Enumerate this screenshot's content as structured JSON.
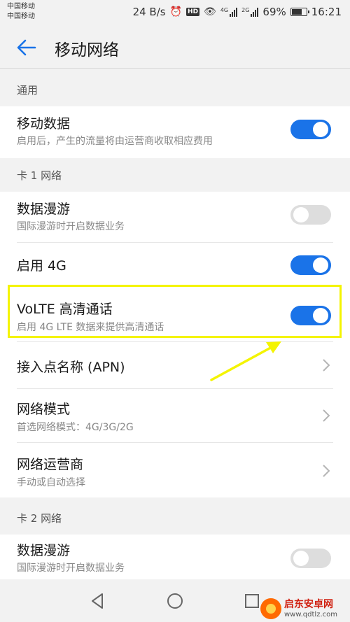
{
  "status_bar": {
    "carrier1": "中国移动",
    "carrier2": "中国移动",
    "speed": "24 B/s",
    "hd": "HD",
    "net1": "4G",
    "net2": "2G",
    "battery": "69%",
    "battery_level": 0.69,
    "time": "16:21"
  },
  "header": {
    "title": "移动网络"
  },
  "sections": {
    "general": {
      "label": "通用"
    },
    "sim1": {
      "label": "卡 1 网络"
    },
    "sim2": {
      "label": "卡 2 网络"
    }
  },
  "rows": {
    "mobile_data": {
      "title": "移动数据",
      "subtitle": "启用后，产生的流量将由运营商收取相应费用",
      "enabled": true
    },
    "roaming1": {
      "title": "数据漫游",
      "subtitle": "国际漫游时开启数据业务",
      "enabled": false
    },
    "enable_4g": {
      "title": "启用 4G",
      "enabled": true
    },
    "volte": {
      "title": "VoLTE 高清通话",
      "subtitle": "启用 4G LTE 数据来提供高清通话",
      "enabled": true
    },
    "apn": {
      "title": "接入点名称 (APN)"
    },
    "network_mode": {
      "title": "网络模式",
      "subtitle": "首选网络模式：4G/3G/2G"
    },
    "operator": {
      "title": "网络运营商",
      "subtitle": "手动或自动选择"
    },
    "roaming2": {
      "title": "数据漫游",
      "subtitle": "国际漫游时开启数据业务",
      "enabled": false
    }
  },
  "watermark": {
    "title": "启东安卓网",
    "url": "www.qdtlz.com"
  },
  "colors": {
    "accent": "#1a73e8",
    "highlight": "#f4f400",
    "background": "#f2f2f2"
  }
}
